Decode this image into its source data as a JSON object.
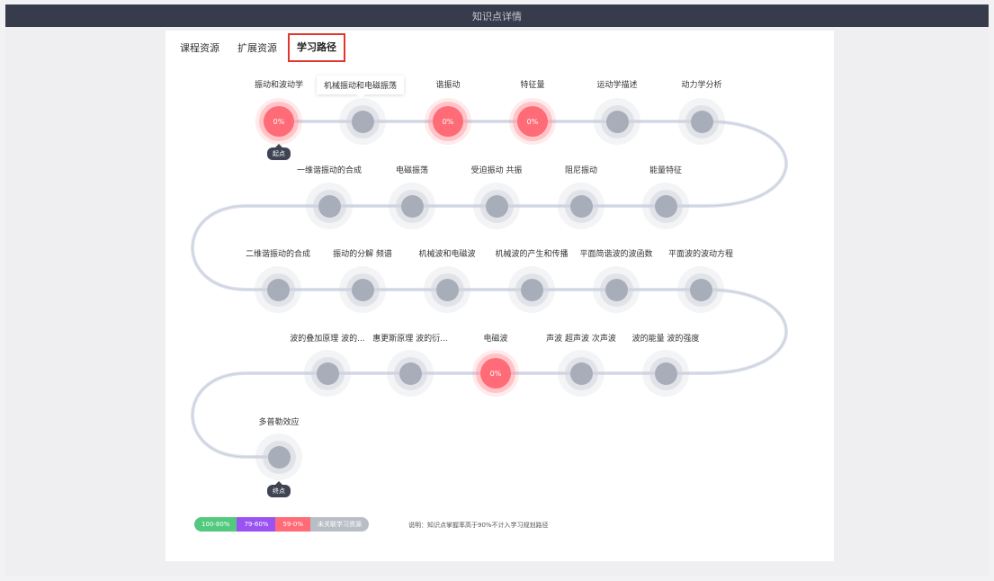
{
  "window": {
    "title": "知识点详情"
  },
  "tabs": [
    {
      "label": "课程资源"
    },
    {
      "label": "扩展资源"
    },
    {
      "label": "学习路径"
    }
  ],
  "path": {
    "rows": [
      {
        "nodes": [
          {
            "label": "振动和波动学",
            "value": "0%",
            "status": "red"
          },
          {
            "label": "",
            "value": "",
            "status": "gray"
          },
          {
            "label": "谐振动",
            "value": "0%",
            "status": "red"
          },
          {
            "label": "特征量",
            "value": "0%",
            "status": "red"
          },
          {
            "label": "运动学描述",
            "value": "",
            "status": "gray"
          },
          {
            "label": "动力学分析",
            "value": "",
            "status": "gray"
          }
        ]
      },
      {
        "nodes": [
          {
            "label": "一维谐振动的合成",
            "value": "",
            "status": "gray"
          },
          {
            "label": "电磁振荡",
            "value": "",
            "status": "gray"
          },
          {
            "label": "受迫振动 共振",
            "value": "",
            "status": "gray"
          },
          {
            "label": "阻尼振动",
            "value": "",
            "status": "gray"
          },
          {
            "label": "能量特征",
            "value": "",
            "status": "gray"
          }
        ]
      },
      {
        "nodes": [
          {
            "label": "二维谐振动的合成",
            "value": "",
            "status": "gray"
          },
          {
            "label": "振动的分解 频谱",
            "value": "",
            "status": "gray"
          },
          {
            "label": "机械波和电磁波",
            "value": "",
            "status": "gray"
          },
          {
            "label": "机械波的产生和传播",
            "value": "",
            "status": "gray"
          },
          {
            "label": "平面简谐波的波函数",
            "value": "",
            "status": "gray"
          },
          {
            "label": "平面波的波动方程",
            "value": "",
            "status": "gray"
          }
        ]
      },
      {
        "nodes": [
          {
            "label": "波的叠加原理 波的...",
            "value": "",
            "status": "gray"
          },
          {
            "label": "惠更斯原理 波的衍...",
            "value": "",
            "status": "gray"
          },
          {
            "label": "电磁波",
            "value": "0%",
            "status": "red"
          },
          {
            "label": "声波 超声波 次声波",
            "value": "",
            "status": "gray"
          },
          {
            "label": "波的能量 波的强度",
            "value": "",
            "status": "gray"
          }
        ]
      },
      {
        "nodes": [
          {
            "label": "多普勒效应",
            "value": "",
            "status": "gray"
          }
        ]
      }
    ],
    "tooltip": "机械振动和电磁振荡",
    "start_label": "起点",
    "end_label": "终点"
  },
  "legend": [
    {
      "label": "100-80%",
      "color": "#52c97e"
    },
    {
      "label": "79-60%",
      "color": "#9b52f2"
    },
    {
      "label": "59-0%",
      "color": "#ff6b77"
    },
    {
      "label": "未关联学习资源",
      "color": "#b9bdc6"
    }
  ],
  "note": "说明：知识点掌握率高于90%不计入学习规划路径"
}
